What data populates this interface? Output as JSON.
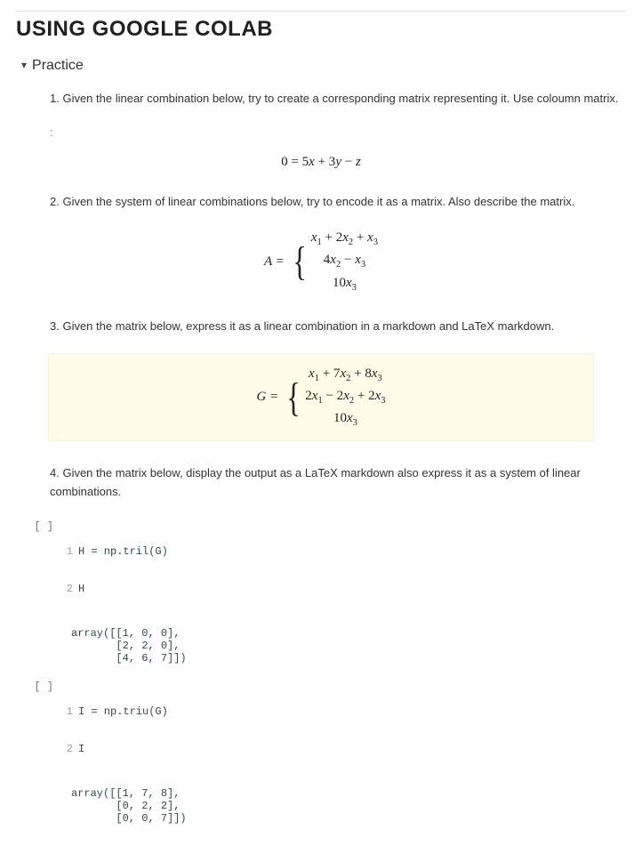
{
  "title": "USING GOOGLE COLAB",
  "section": {
    "label": "Practice"
  },
  "problems": {
    "p1": "1. Given the linear combination below, try to create a corresponding matrix representing it. Use coloumn matrix.",
    "eq1_display": "0 = 5x + 3y − z",
    "p2": "2. Given the system of linear combinations below, try to encode it as a matrix. Also describe the matrix.",
    "eq2": {
      "label": "A =",
      "row1": "x₁ + 2x₂ + x₃",
      "row2": "4x₂ − x₃",
      "row3": "10x₃"
    },
    "p3": "3. Given the matrix below, express it as a linear combination in a markdown and LaTeX markdown.",
    "eq3": {
      "label": "G =",
      "row1": "x₁ + 7x₂ + 8x₃",
      "row2": "2x₁ − 2x₂ + 2x₃",
      "row3": "10x₃"
    },
    "p4": "4. Given the matrix below, display the output as a LaTeX markdown also express it as a system of linear combinations."
  },
  "cells": [
    {
      "gutter": "[ ]",
      "ln1": {
        "no": "1",
        "code": "H = np.tril(G)"
      },
      "ln2": {
        "no": "2",
        "code": "H"
      },
      "output": "array([[1, 0, 0],\n       [2, 2, 0],\n       [4, 6, 7]])"
    },
    {
      "gutter": "[ ]",
      "ln1": {
        "no": "1",
        "code": "I = np.triu(G)"
      },
      "ln2": {
        "no": "2",
        "code": "I"
      },
      "output": "array([[1, 7, 8],\n       [0, 2, 2],\n       [0, 0, 7]])"
    }
  ]
}
